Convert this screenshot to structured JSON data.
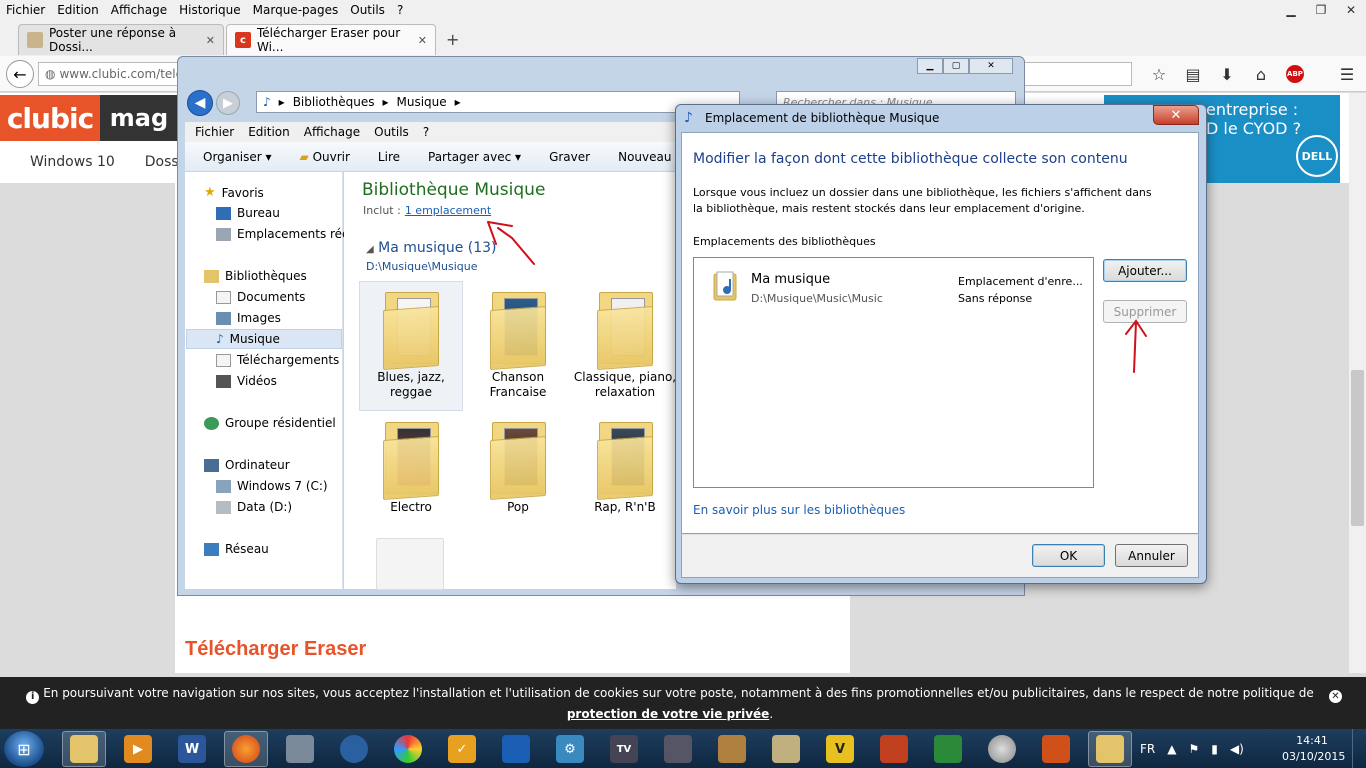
{
  "browser": {
    "menu": [
      "Fichier",
      "Edition",
      "Affichage",
      "Historique",
      "Marque-pages",
      "Outils",
      "?"
    ],
    "tabs": [
      {
        "label": "Poster une réponse à Dossi...",
        "active": false
      },
      {
        "label": "Télécharger Eraser pour Wi...",
        "active": true
      }
    ],
    "url": "www.clubic.com/tele"
  },
  "site": {
    "logo_left": "clubic",
    "logo_right": "mag",
    "nav": [
      "Windows 10",
      "Dossie"
    ],
    "ad_text_line1": "entreprise :",
    "ad_text_line2": "D le CYOD ?",
    "ad_brand": "DELL",
    "page_title": "Télécharger Eraser"
  },
  "cookie": {
    "text": "En poursuivant votre navigation sur nos sites, vous acceptez l'installation et l'utilisation de cookies sur votre poste, notamment à des fins promotionnelles et/ou publicitaires, dans le respect de notre politique de",
    "link": "protection de votre vie privée",
    "end": "."
  },
  "explorer": {
    "breadcrumb": [
      "Bibliothèques",
      "Musique"
    ],
    "search_placeholder": "Rechercher dans : Musique",
    "menu": [
      "Fichier",
      "Edition",
      "Affichage",
      "Outils",
      "?"
    ],
    "toolbar": [
      "Organiser",
      "Ouvrir",
      "Lire",
      "Partager avec",
      "Graver",
      "Nouveau do"
    ],
    "nav": {
      "favorites": "Favoris",
      "desktop": "Bureau",
      "recent": "Emplacements récen",
      "libraries": "Bibliothèques",
      "documents": "Documents",
      "images": "Images",
      "music": "Musique",
      "downloads": "Téléchargements",
      "videos": "Vidéos",
      "homegroup": "Groupe résidentiel",
      "computer": "Ordinateur",
      "drive_c": "Windows 7 (C:)",
      "drive_d": "Data (D:)",
      "network": "Réseau"
    },
    "library_title": "Bibliothèque Musique",
    "includes_label": "Inclut :",
    "includes_link": "1 emplacement",
    "group_title": "Ma musique (13)",
    "group_path": "D:\\Musique\\Musique",
    "folders": [
      {
        "name": "Blues, jazz, reggae"
      },
      {
        "name": "Chanson Francaise"
      },
      {
        "name": "Classique, piano, relaxation"
      },
      {
        "name": "Electro"
      },
      {
        "name": "Pop"
      },
      {
        "name": "Rap, R'n'B"
      }
    ]
  },
  "dialog": {
    "title": "Emplacement de bibliothèque Musique",
    "heading": "Modifier la façon dont cette bibliothèque collecte son contenu",
    "description": "Lorsque vous incluez un dossier dans une bibliothèque, les fichiers s'affichent dans la bibliothèque, mais restent stockés dans leur emplacement d'origine.",
    "section_label": "Emplacements des bibliothèques",
    "location": {
      "name": "Ma musique",
      "path": "D:\\Musique\\Music\\Music",
      "type": "Emplacement d'enre...",
      "status": "Sans réponse"
    },
    "add_button": "Ajouter...",
    "remove_button": "Supprimer",
    "learn_more": "En savoir plus sur les bibliothèques",
    "ok": "OK",
    "cancel": "Annuler"
  },
  "taskbar": {
    "lang": "FR",
    "time": "14:41",
    "date": "03/10/2015"
  }
}
